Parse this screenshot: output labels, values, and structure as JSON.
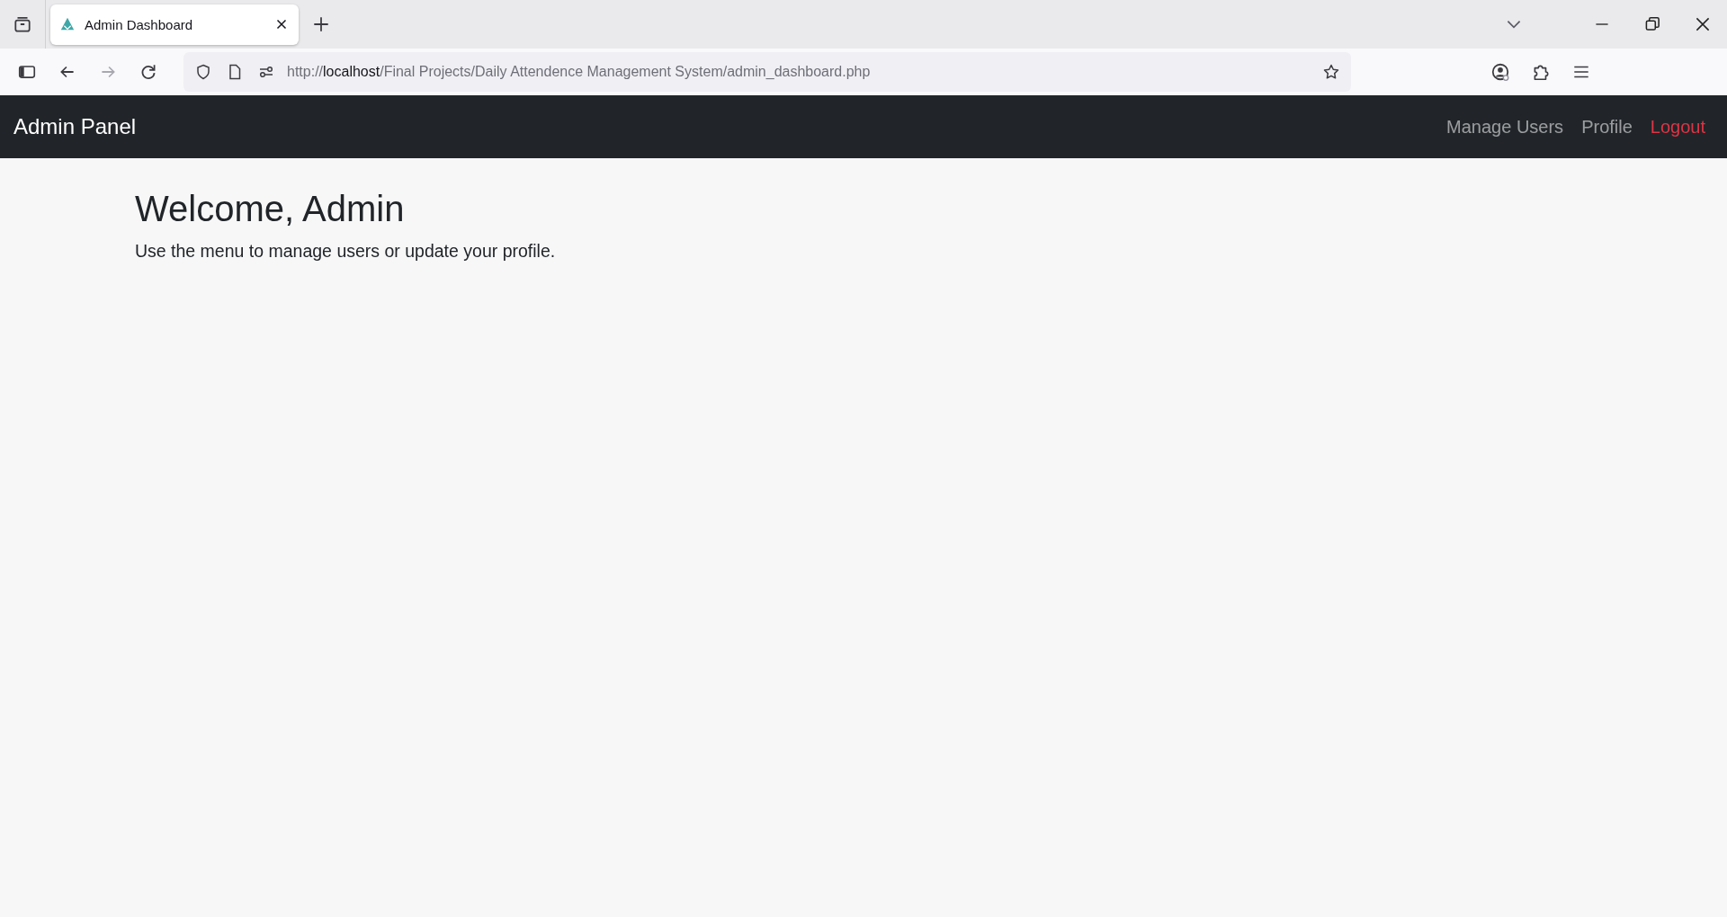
{
  "browser": {
    "tabs": [
      {
        "title": "Admin Dashboard",
        "selected": true
      }
    ],
    "url": {
      "scheme": "http://",
      "host": "localhost",
      "path": "/Final Projects/Daily Attendence Management System/admin_dashboard.php"
    }
  },
  "navbar": {
    "brand": "Admin Panel",
    "links": [
      {
        "label": "Manage Users",
        "kind": "normal"
      },
      {
        "label": "Profile",
        "kind": "normal"
      },
      {
        "label": "Logout",
        "kind": "danger"
      }
    ]
  },
  "main": {
    "heading": "Welcome, Admin",
    "text": "Use the menu to manage users or update your profile."
  }
}
